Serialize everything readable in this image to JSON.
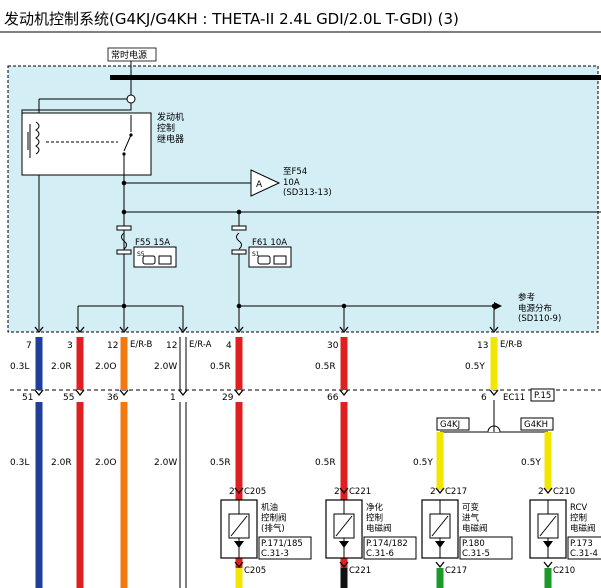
{
  "title": "发动机控制系统(G4KJ/G4KH : THETA-II 2.4L GDI/2.0L T-GDI) (3)",
  "power_label": "常时电源",
  "relay": {
    "line1": "发动机",
    "line2": "控制",
    "line3": "继电器"
  },
  "connector_a": {
    "symbol": "A",
    "to_label": "至F54",
    "rating": "10A",
    "ref": "(SD313-13)"
  },
  "fuse_f55": {
    "name": "F55 15A",
    "code": "S5"
  },
  "fuse_f61": {
    "name": "F61 10A",
    "code": "S1"
  },
  "ref_dist": {
    "line1": "参考",
    "line2": "电源分布",
    "ref": "(SD110-9)"
  },
  "harness_top": {
    "er_b_left": "E/R-B",
    "er_a": "E/R-A",
    "er_b_right": "E/R-B"
  },
  "ec11": {
    "label": "EC11",
    "page": "P.15"
  },
  "variants": {
    "g4kj": "G4KJ",
    "g4kh": "G4KH"
  },
  "wires": [
    {
      "pin_top": "7",
      "spec_top": "0.3L",
      "pin_mid": "51",
      "spec_bot": "0.3L",
      "color": "#1f3f9a"
    },
    {
      "pin_top": "3",
      "spec_top": "2.0R",
      "pin_mid": "55",
      "spec_bot": "2.0R",
      "color": "#e02020"
    },
    {
      "pin_top": "12",
      "spec_top": "2.0O",
      "pin_mid": "36",
      "spec_bot": "2.0O",
      "color": "#f07a10"
    },
    {
      "pin_top": "12",
      "spec_top": "2.0W",
      "pin_mid": "1",
      "spec_bot": "2.0W",
      "color": "#ffffff"
    },
    {
      "pin_top": "4",
      "spec_top": "0.5R",
      "pin_mid": "29",
      "spec_bot": "0.5R",
      "color": "#e02020"
    },
    {
      "pin_top": "30",
      "spec_top": "0.5R",
      "pin_mid": "66",
      "spec_bot": "0.5R",
      "color": "#e02020"
    },
    {
      "pin_top": "13",
      "spec_top": "0.5Y",
      "pin_mid": "6",
      "spec_bot_left": "0.5Y",
      "spec_bot_right": "0.5Y",
      "color": "#f2e600"
    }
  ],
  "components": [
    {
      "pin": "2",
      "conn": "C205",
      "name": [
        "机油",
        "控制阀",
        "(排气)"
      ],
      "page": "P.171/185",
      "sub": "C.31-3",
      "lower_color": "#f2e600"
    },
    {
      "pin": "2",
      "conn": "C221",
      "name": [
        "净化",
        "控制",
        "电磁阀"
      ],
      "page": "P.174/182",
      "sub": "C.31-6",
      "lower_color": "#111111"
    },
    {
      "pin": "2",
      "conn": "C217",
      "name": [
        "可变",
        "进气",
        "电磁阀"
      ],
      "page": "P.180",
      "sub": "C.31-5",
      "lower_color": "#1a9a2a"
    },
    {
      "pin": "2",
      "conn": "C210",
      "name": [
        "RCV",
        "控制",
        "电磁阀"
      ],
      "page": "P.173",
      "sub": "C.31-4",
      "lower_color": "#1a9a2a"
    }
  ],
  "component_bottom_conns": [
    "C205",
    "C221",
    "C217",
    "C210"
  ]
}
